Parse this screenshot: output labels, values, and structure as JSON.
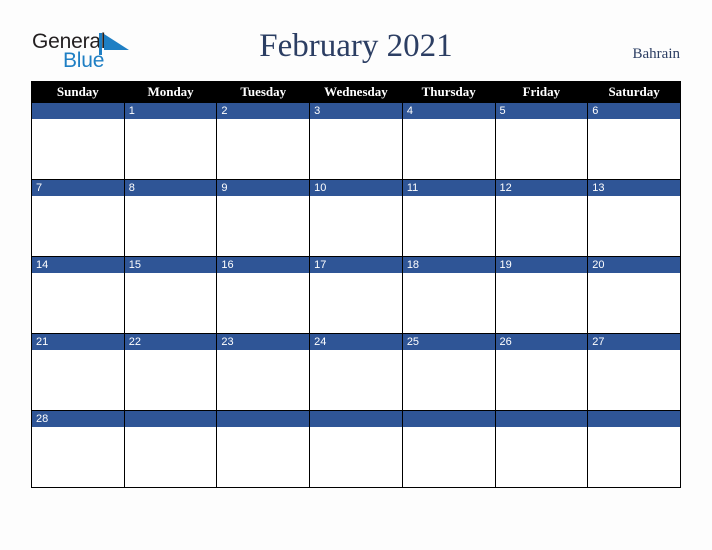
{
  "brand": {
    "name_part1": "General",
    "name_part2": "Blue",
    "mark": "triangle-logo-icon",
    "color_dark": "#231f20",
    "color_blue": "#1f7fc4"
  },
  "header": {
    "title": "February 2021",
    "country": "Bahrain",
    "title_color": "#2c3e63"
  },
  "calendar": {
    "header_bg": "#000000",
    "header_text_color": "#ffffff",
    "day_band_color": "#2f5596",
    "day_number_color": "#ffffff",
    "cell_bg": "#ffffff",
    "border_color": "#000000",
    "weekdays": [
      "Sunday",
      "Monday",
      "Tuesday",
      "Wednesday",
      "Thursday",
      "Friday",
      "Saturday"
    ],
    "weeks": [
      [
        {
          "day": ""
        },
        {
          "day": "1"
        },
        {
          "day": "2"
        },
        {
          "day": "3"
        },
        {
          "day": "4"
        },
        {
          "day": "5"
        },
        {
          "day": "6"
        }
      ],
      [
        {
          "day": "7"
        },
        {
          "day": "8"
        },
        {
          "day": "9"
        },
        {
          "day": "10"
        },
        {
          "day": "11"
        },
        {
          "day": "12"
        },
        {
          "day": "13"
        }
      ],
      [
        {
          "day": "14"
        },
        {
          "day": "15"
        },
        {
          "day": "16"
        },
        {
          "day": "17"
        },
        {
          "day": "18"
        },
        {
          "day": "19"
        },
        {
          "day": "20"
        }
      ],
      [
        {
          "day": "21"
        },
        {
          "day": "22"
        },
        {
          "day": "23"
        },
        {
          "day": "24"
        },
        {
          "day": "25"
        },
        {
          "day": "26"
        },
        {
          "day": "27"
        }
      ],
      [
        {
          "day": "28"
        },
        {
          "day": ""
        },
        {
          "day": ""
        },
        {
          "day": ""
        },
        {
          "day": ""
        },
        {
          "day": ""
        },
        {
          "day": ""
        }
      ]
    ]
  }
}
